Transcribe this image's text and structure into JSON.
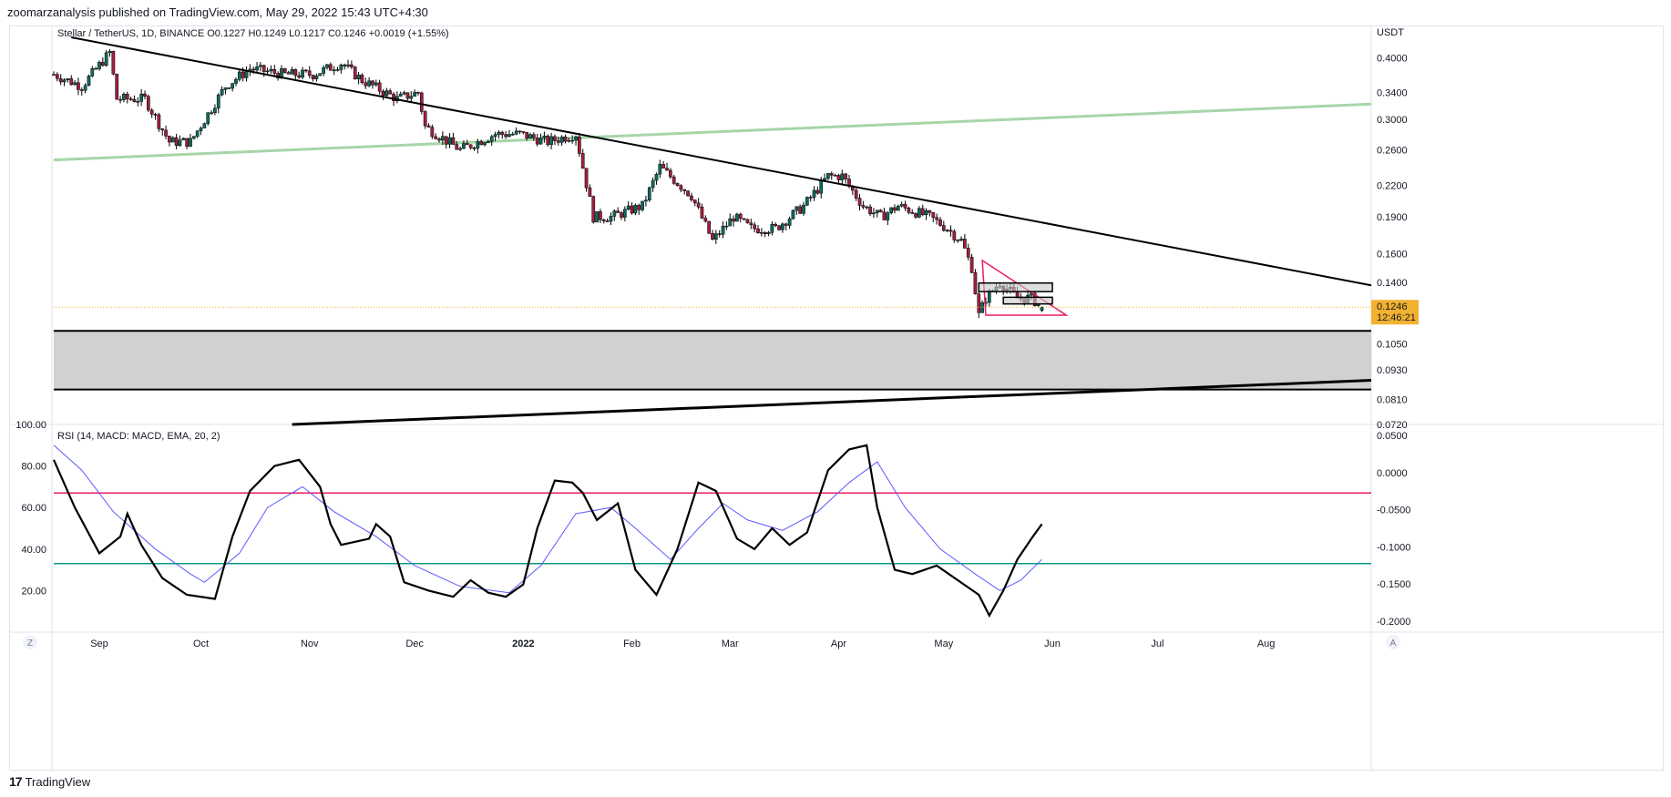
{
  "header": {
    "published": "zoomarzanalysis published on TradingView.com, May 29, 2022 15:43 UTC+4:30"
  },
  "main_pane": {
    "legend": "Stellar / TetherUS, 1D, BINANCE  O0.1227  H0.1249  L0.1217  C0.1246  +0.0019 (+1.55%)",
    "currency": "USDT",
    "price_ticks": [
      "0.4000",
      "0.3400",
      "0.3000",
      "0.2600",
      "0.2200",
      "0.1900",
      "0.1600",
      "0.1400",
      "0.1050",
      "0.0930",
      "0.0810",
      "0.0720"
    ],
    "last_price": "0.1246",
    "countdown": "12:46:21",
    "last_price_color": "#f2b130"
  },
  "indicator_pane": {
    "legend": "RSI (14, MACD: MACD, EMA, 20, 2)",
    "left_ticks": [
      "100.00",
      "80.00",
      "60.00",
      "40.00",
      "20.00"
    ],
    "right_ticks": [
      "0.0500",
      "0.0000",
      "-0.0500",
      "-0.1000",
      "-0.1500",
      "-0.2000"
    ],
    "upper_line_color": "#e91e63",
    "lower_line_color": "#089981"
  },
  "time_axis": {
    "labels": [
      "Sep",
      "Oct",
      "Nov",
      "Dec",
      "2022",
      "Feb",
      "Mar",
      "Apr",
      "May",
      "Jun",
      "Jul",
      "Aug"
    ],
    "z_button": "Z",
    "a_button": "A"
  },
  "footer": {
    "brand": "TradingView",
    "logo": "17"
  },
  "colors": {
    "up": "#26a69a",
    "down": "#ef5350",
    "body_up": "#0d6b5f",
    "body_down": "#a0203d",
    "green_channel": "#a5d6a7",
    "support_zone": "#d1d1d1",
    "triangle": "#e91e63",
    "rsi": "#000000",
    "signal": "#5b5bff"
  },
  "chart_data": [
    {
      "type": "candlestick",
      "title": "Stellar / TetherUS, 1D, BINANCE",
      "xlabel": "",
      "ylabel": "USDT",
      "scale": "log",
      "ylim": [
        0.072,
        0.44
      ],
      "x_range": [
        "2021-08-20",
        "2022-08-31"
      ],
      "last": {
        "date": "2022-05-29",
        "open": 0.1227,
        "high": 0.1249,
        "low": 0.1217,
        "close": 0.1246,
        "change": 0.0019,
        "change_pct": 1.55
      },
      "close_path": [
        {
          "date": "2021-08-20",
          "close": 0.37
        },
        {
          "date": "2021-08-28",
          "close": 0.35
        },
        {
          "date": "2021-09-05",
          "close": 0.41
        },
        {
          "date": "2021-09-07",
          "close": 0.33
        },
        {
          "date": "2021-09-15",
          "close": 0.33
        },
        {
          "date": "2021-09-22",
          "close": 0.27
        },
        {
          "date": "2021-09-28",
          "close": 0.27
        },
        {
          "date": "2021-10-08",
          "close": 0.35
        },
        {
          "date": "2021-10-15",
          "close": 0.38
        },
        {
          "date": "2021-10-25",
          "close": 0.37
        },
        {
          "date": "2021-11-02",
          "close": 0.37
        },
        {
          "date": "2021-11-10",
          "close": 0.39
        },
        {
          "date": "2021-11-16",
          "close": 0.36
        },
        {
          "date": "2021-11-26",
          "close": 0.33
        },
        {
          "date": "2021-12-02",
          "close": 0.34
        },
        {
          "date": "2021-12-04",
          "close": 0.29
        },
        {
          "date": "2021-12-14",
          "close": 0.26
        },
        {
          "date": "2021-12-24",
          "close": 0.28
        },
        {
          "date": "2021-12-31",
          "close": 0.28
        },
        {
          "date": "2022-01-08",
          "close": 0.27
        },
        {
          "date": "2022-01-16",
          "close": 0.28
        },
        {
          "date": "2022-01-21",
          "close": 0.19
        },
        {
          "date": "2022-01-26",
          "close": 0.19
        },
        {
          "date": "2022-02-04",
          "close": 0.2
        },
        {
          "date": "2022-02-09",
          "close": 0.24
        },
        {
          "date": "2022-02-18",
          "close": 0.21
        },
        {
          "date": "2022-02-24",
          "close": 0.17
        },
        {
          "date": "2022-03-02",
          "close": 0.19
        },
        {
          "date": "2022-03-07",
          "close": 0.18
        },
        {
          "date": "2022-03-14",
          "close": 0.18
        },
        {
          "date": "2022-03-22",
          "close": 0.2
        },
        {
          "date": "2022-03-29",
          "close": 0.23
        },
        {
          "date": "2022-04-02",
          "close": 0.23
        },
        {
          "date": "2022-04-08",
          "close": 0.2
        },
        {
          "date": "2022-04-13",
          "close": 0.19
        },
        {
          "date": "2022-04-18",
          "close": 0.2
        },
        {
          "date": "2022-04-27",
          "close": 0.19
        },
        {
          "date": "2022-05-02",
          "close": 0.18
        },
        {
          "date": "2022-05-06",
          "close": 0.17
        },
        {
          "date": "2022-05-09",
          "close": 0.15
        },
        {
          "date": "2022-05-11",
          "close": 0.12
        },
        {
          "date": "2022-05-13",
          "close": 0.13
        },
        {
          "date": "2022-05-17",
          "close": 0.14
        },
        {
          "date": "2022-05-22",
          "close": 0.13
        },
        {
          "date": "2022-05-26",
          "close": 0.13
        },
        {
          "date": "2022-05-29",
          "close": 0.1246
        }
      ],
      "trendlines": [
        {
          "name": "descending resistance",
          "from": {
            "date": "2021-08-25",
            "value": 0.44
          },
          "to": {
            "date": "2022-08-31",
            "value": 0.138
          }
        },
        {
          "name": "green channel",
          "from": {
            "date": "2021-08-20",
            "value": 0.248
          },
          "to": {
            "date": "2022-08-31",
            "value": 0.322
          }
        },
        {
          "name": "ascending support",
          "from": {
            "date": "2021-10-27",
            "value": 0.072
          },
          "to": {
            "date": "2022-08-31",
            "value": 0.0885
          }
        }
      ],
      "support_zone": {
        "top": 0.1115,
        "bottom": 0.0848
      },
      "triangle": [
        {
          "date": "2022-05-12",
          "value": 0.155
        },
        {
          "date": "2022-06-05",
          "value": 0.12
        },
        {
          "date": "2022-05-13",
          "value": 0.12
        }
      ],
      "boxes": [
        {
          "from": "2022-05-11",
          "to": "2022-06-01",
          "top": 0.1395,
          "bottom": 0.134
        },
        {
          "from": "2022-05-18",
          "to": "2022-06-01",
          "top": 0.1305,
          "bottom": 0.1265
        }
      ]
    },
    {
      "type": "line",
      "title": "RSI (14, MACD: MACD, EMA, 20, 2)",
      "xlabel": "",
      "ylabel": "",
      "ylim": [
        0,
        100
      ],
      "y2lim": [
        -0.215,
        0.065
      ],
      "levels": [
        67,
        33
      ],
      "series": [
        {
          "color": "#000000",
          "points": [
            {
              "date": "2021-08-20",
              "value": 83
            },
            {
              "date": "2021-08-26",
              "value": 60
            },
            {
              "date": "2021-09-02",
              "value": 38
            },
            {
              "date": "2021-09-08",
              "value": 46
            },
            {
              "date": "2021-09-10",
              "value": 57
            },
            {
              "date": "2021-09-14",
              "value": 42
            },
            {
              "date": "2021-09-20",
              "value": 26
            },
            {
              "date": "2021-09-27",
              "value": 18
            },
            {
              "date": "2021-10-05",
              "value": 16
            },
            {
              "date": "2021-10-10",
              "value": 46
            },
            {
              "date": "2021-10-15",
              "value": 68
            },
            {
              "date": "2021-10-22",
              "value": 80
            },
            {
              "date": "2021-10-29",
              "value": 83
            },
            {
              "date": "2021-11-04",
              "value": 70
            },
            {
              "date": "2021-11-07",
              "value": 52
            },
            {
              "date": "2021-11-10",
              "value": 42
            },
            {
              "date": "2021-11-18",
              "value": 45
            },
            {
              "date": "2021-11-20",
              "value": 52
            },
            {
              "date": "2021-11-24",
              "value": 46
            },
            {
              "date": "2021-11-28",
              "value": 24
            },
            {
              "date": "2021-12-05",
              "value": 20
            },
            {
              "date": "2021-12-12",
              "value": 17
            },
            {
              "date": "2021-12-17",
              "value": 25
            },
            {
              "date": "2021-12-22",
              "value": 19
            },
            {
              "date": "2021-12-27",
              "value": 17
            },
            {
              "date": "2022-01-01",
              "value": 23
            },
            {
              "date": "2022-01-05",
              "value": 50
            },
            {
              "date": "2022-01-10",
              "value": 73
            },
            {
              "date": "2022-01-15",
              "value": 72
            },
            {
              "date": "2022-01-18",
              "value": 67
            },
            {
              "date": "2022-01-22",
              "value": 54
            },
            {
              "date": "2022-01-28",
              "value": 62
            },
            {
              "date": "2022-02-02",
              "value": 30
            },
            {
              "date": "2022-02-08",
              "value": 18
            },
            {
              "date": "2022-02-14",
              "value": 40
            },
            {
              "date": "2022-02-20",
              "value": 72
            },
            {
              "date": "2022-02-25",
              "value": 68
            },
            {
              "date": "2022-03-03",
              "value": 45
            },
            {
              "date": "2022-03-08",
              "value": 40
            },
            {
              "date": "2022-03-13",
              "value": 50
            },
            {
              "date": "2022-03-18",
              "value": 42
            },
            {
              "date": "2022-03-23",
              "value": 48
            },
            {
              "date": "2022-03-29",
              "value": 78
            },
            {
              "date": "2022-04-04",
              "value": 88
            },
            {
              "date": "2022-04-09",
              "value": 90
            },
            {
              "date": "2022-04-12",
              "value": 60
            },
            {
              "date": "2022-04-17",
              "value": 30
            },
            {
              "date": "2022-04-22",
              "value": 28
            },
            {
              "date": "2022-04-29",
              "value": 32
            },
            {
              "date": "2022-05-05",
              "value": 25
            },
            {
              "date": "2022-05-11",
              "value": 18
            },
            {
              "date": "2022-05-14",
              "value": 8
            },
            {
              "date": "2022-05-18",
              "value": 20
            },
            {
              "date": "2022-05-22",
              "value": 35
            },
            {
              "date": "2022-05-26",
              "value": 45
            },
            {
              "date": "2022-05-29",
              "value": 52
            }
          ]
        },
        {
          "color": "#5b5bff",
          "points": [
            {
              "date": "2021-08-20",
              "value": 90
            },
            {
              "date": "2021-08-28",
              "value": 78
            },
            {
              "date": "2021-09-06",
              "value": 58
            },
            {
              "date": "2021-09-18",
              "value": 40
            },
            {
              "date": "2021-09-28",
              "value": 28
            },
            {
              "date": "2021-10-02",
              "value": 24
            },
            {
              "date": "2021-10-12",
              "value": 38
            },
            {
              "date": "2021-10-20",
              "value": 60
            },
            {
              "date": "2021-10-30",
              "value": 70
            },
            {
              "date": "2021-11-08",
              "value": 58
            },
            {
              "date": "2021-11-20",
              "value": 46
            },
            {
              "date": "2021-12-01",
              "value": 32
            },
            {
              "date": "2021-12-14",
              "value": 22
            },
            {
              "date": "2021-12-28",
              "value": 19
            },
            {
              "date": "2022-01-06",
              "value": 32
            },
            {
              "date": "2022-01-16",
              "value": 57
            },
            {
              "date": "2022-01-26",
              "value": 60
            },
            {
              "date": "2022-02-02",
              "value": 50
            },
            {
              "date": "2022-02-12",
              "value": 35
            },
            {
              "date": "2022-02-20",
              "value": 50
            },
            {
              "date": "2022-02-27",
              "value": 62
            },
            {
              "date": "2022-03-06",
              "value": 54
            },
            {
              "date": "2022-03-16",
              "value": 49
            },
            {
              "date": "2022-03-26",
              "value": 58
            },
            {
              "date": "2022-04-04",
              "value": 72
            },
            {
              "date": "2022-04-12",
              "value": 82
            },
            {
              "date": "2022-04-20",
              "value": 60
            },
            {
              "date": "2022-04-30",
              "value": 40
            },
            {
              "date": "2022-05-10",
              "value": 28
            },
            {
              "date": "2022-05-17",
              "value": 20
            },
            {
              "date": "2022-05-23",
              "value": 25
            },
            {
              "date": "2022-05-29",
              "value": 35
            }
          ]
        }
      ]
    }
  ]
}
